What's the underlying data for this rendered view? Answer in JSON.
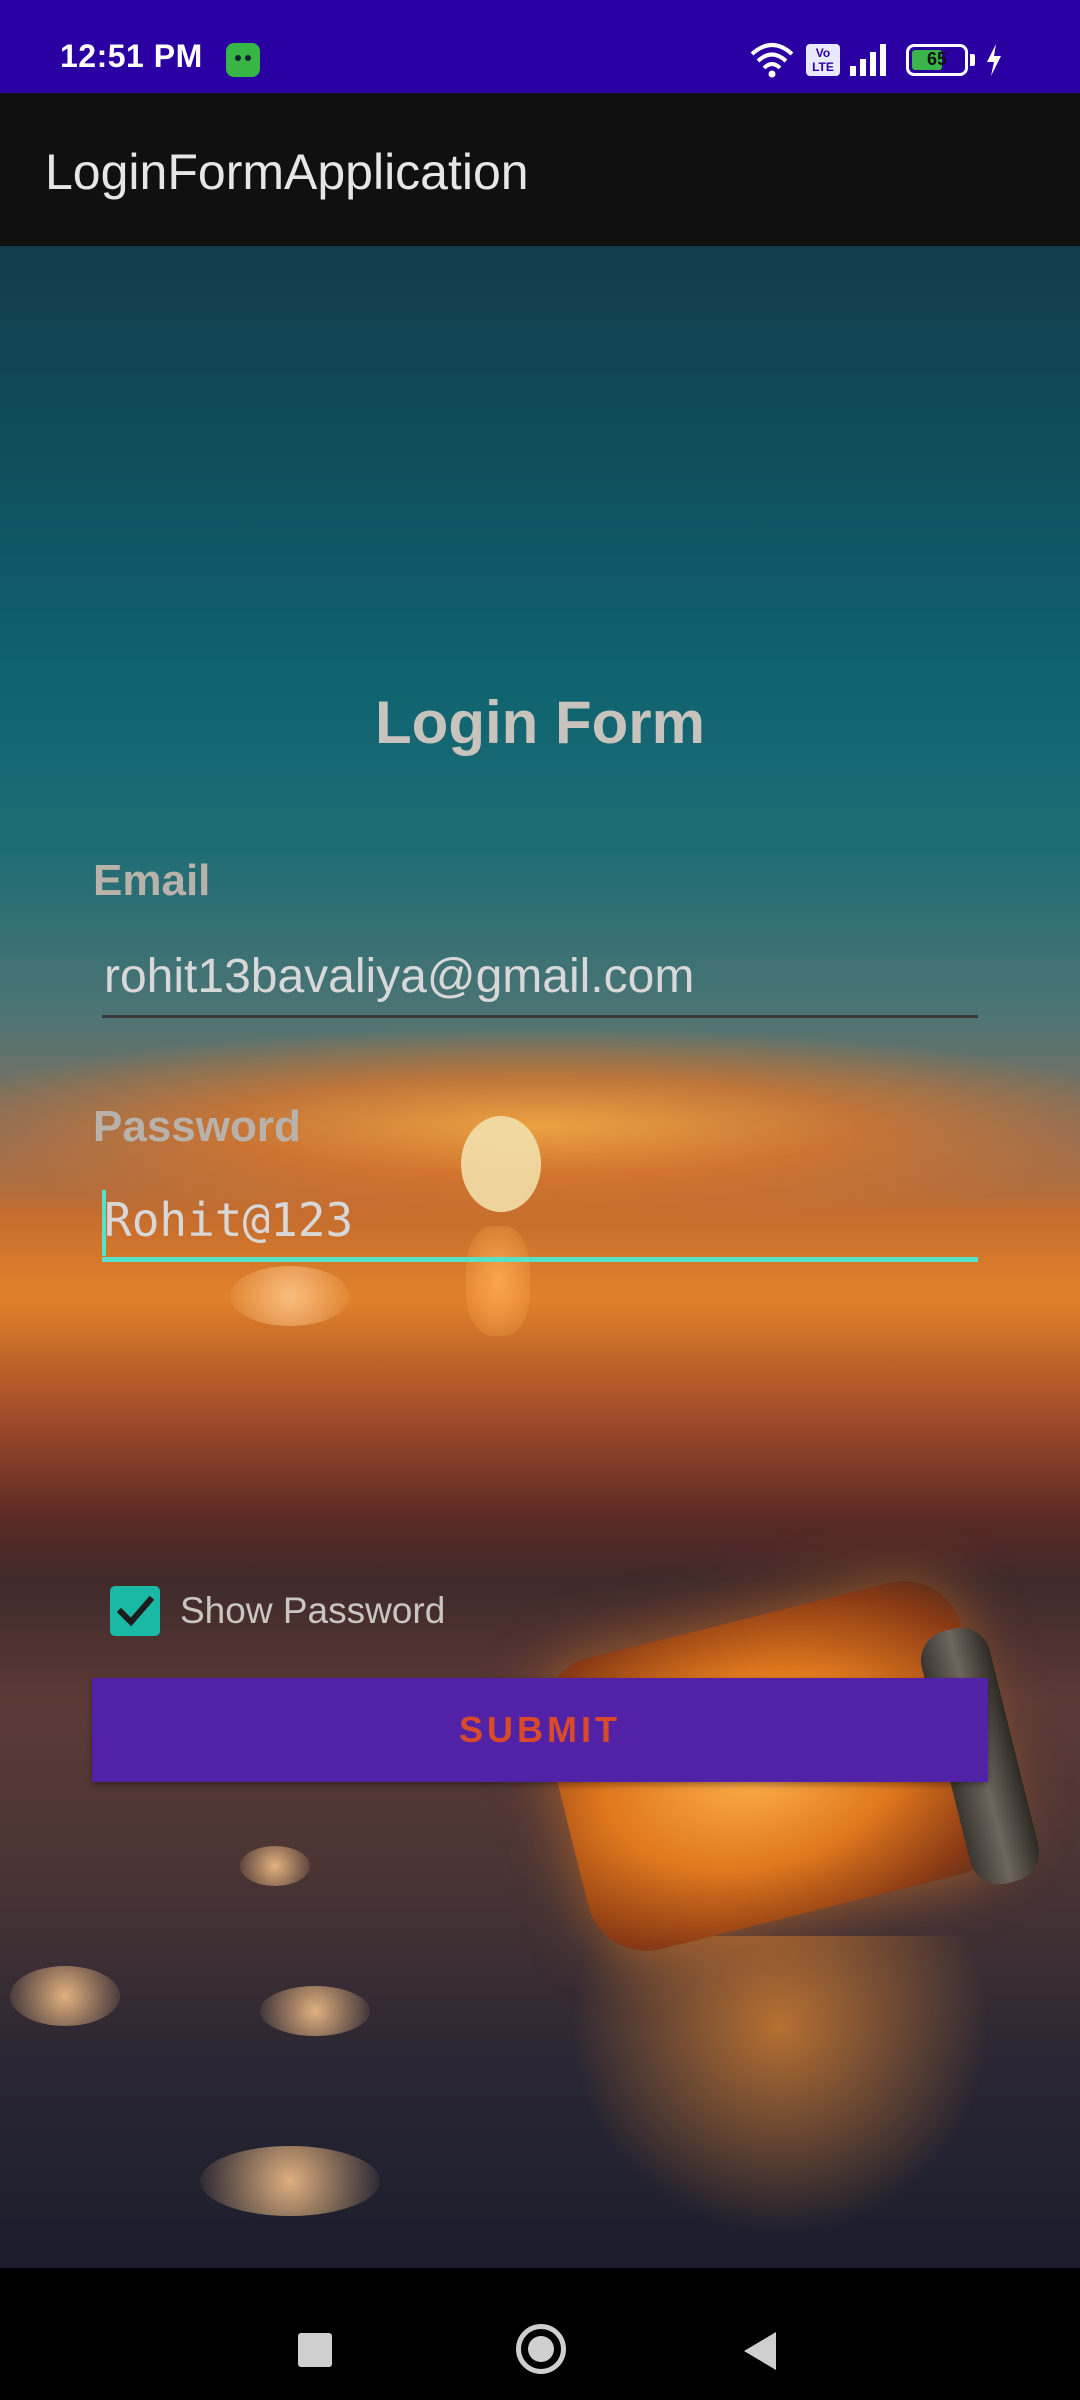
{
  "status_bar": {
    "time": "12:51 PM",
    "volte": "Vo LTE",
    "battery_percent": "65",
    "battery_level": 0.65,
    "icons": [
      "app-notification-icon",
      "wifi-icon",
      "volte-icon",
      "signal-icon",
      "battery-icon",
      "charging-icon"
    ]
  },
  "app_bar": {
    "title": "LoginFormApplication"
  },
  "form": {
    "title": "Login Form",
    "email_label": "Email",
    "email_value": "rohit13bavaliya@gmail.com",
    "password_label": "Password",
    "password_value": "Rohit@123",
    "show_password_label": "Show Password",
    "show_password_checked": true,
    "submit_label": "SUBMIT"
  },
  "colors": {
    "status_bar": "#2b00a3",
    "app_bar": "#101010",
    "accent": "#55e2c8",
    "checkbox": "#1ab9a6",
    "button": "#5122a5",
    "button_text": "#d94a2a"
  },
  "nav_bar": {
    "buttons": [
      "recents-button",
      "home-button",
      "back-button"
    ]
  }
}
